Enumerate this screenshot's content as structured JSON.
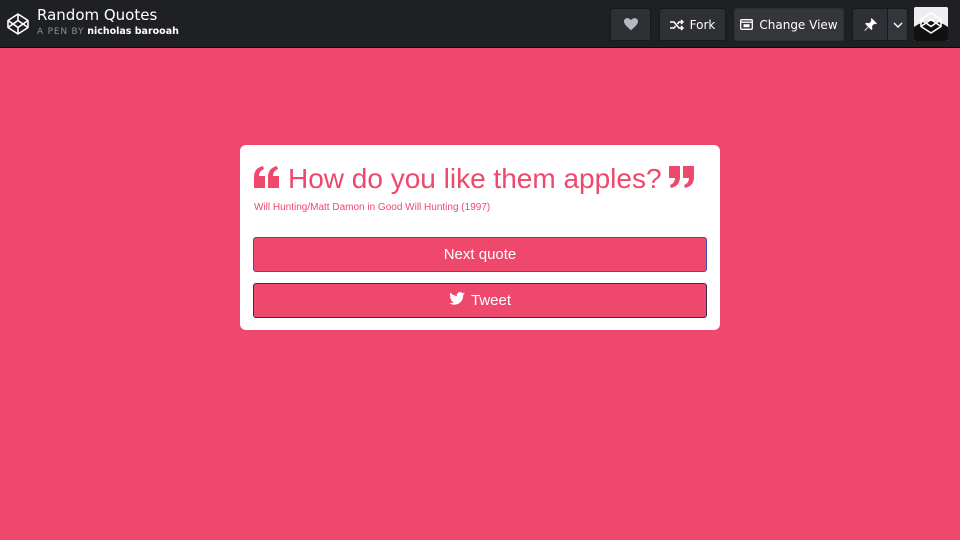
{
  "header": {
    "pen_title": "Random Quotes",
    "by_prefix": "A PEN BY",
    "author": "nicholas barooah",
    "fork_label": "Fork",
    "change_view_label": "Change View"
  },
  "quote": {
    "text": "How do you like them apples?",
    "author": "Will Hunting/Matt Damon in Good Will Hunting (1997)"
  },
  "buttons": {
    "next_label": "Next quote",
    "tweet_label": "Tweet"
  },
  "icons": {
    "logo": "codepen-logo-icon",
    "heart": "heart-icon",
    "fork": "fork-icon",
    "change_view": "change-view-icon",
    "pin": "pin-icon",
    "dropdown": "chevron-down-icon",
    "quote_left": "quote-left-icon",
    "quote_right": "quote-right-icon",
    "twitter": "twitter-bird-icon"
  },
  "colors": {
    "background": "#ee486c",
    "header": "#1f2023",
    "card": "#ffffff",
    "accent": "#ee486c"
  }
}
